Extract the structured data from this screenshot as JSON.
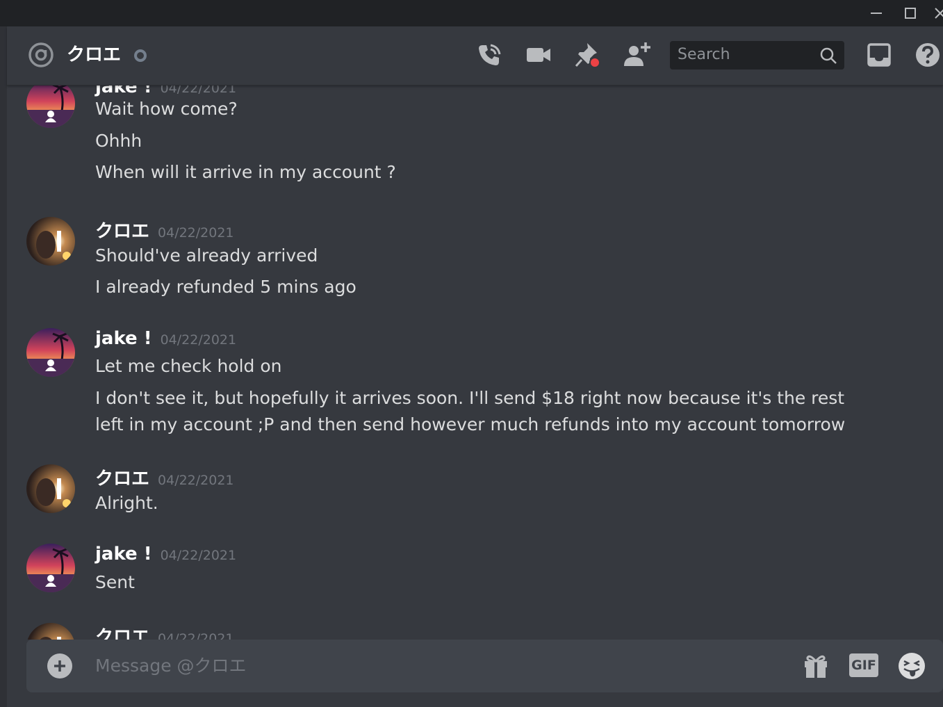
{
  "header": {
    "dm_name": "クロエ",
    "search_placeholder": "Search"
  },
  "messages": [
    {
      "author": "jake !",
      "timestamp": "04/22/2021",
      "lines": [
        "Wait how come?",
        "Ohhh",
        "When will it arrive in my account ?"
      ]
    },
    {
      "author": "クロエ",
      "timestamp": "04/22/2021",
      "lines": [
        "Should've already arrived",
        "I already refunded 5 mins ago"
      ]
    },
    {
      "author": "jake !",
      "timestamp": "04/22/2021",
      "lines": [
        "Let me check hold on",
        "I don't see it, but hopefully it arrives soon. I'll send $18 right now because it's the rest left in my account ;P and then send however much refunds into my account tomorrow"
      ]
    },
    {
      "author": "クロエ",
      "timestamp": "04/22/2021",
      "lines": [
        "Alright."
      ]
    },
    {
      "author": "jake !",
      "timestamp": "04/22/2021",
      "lines": [
        "Sent"
      ]
    },
    {
      "author": "クロエ",
      "timestamp": "04/22/2021",
      "lines": []
    }
  ],
  "composer": {
    "placeholder": "Message @クロエ",
    "gif_label": "GIF"
  },
  "colors": {
    "background": "#36393f",
    "titlebar": "#202225",
    "composer": "#40444b",
    "notification_red": "#ed4245"
  },
  "icons": [
    "at-icon",
    "call-icon",
    "video-icon",
    "pin-icon",
    "add-friend-icon",
    "search-icon",
    "inbox-icon",
    "help-icon",
    "plus-icon",
    "gift-icon",
    "gif-icon",
    "emoji-icon"
  ]
}
